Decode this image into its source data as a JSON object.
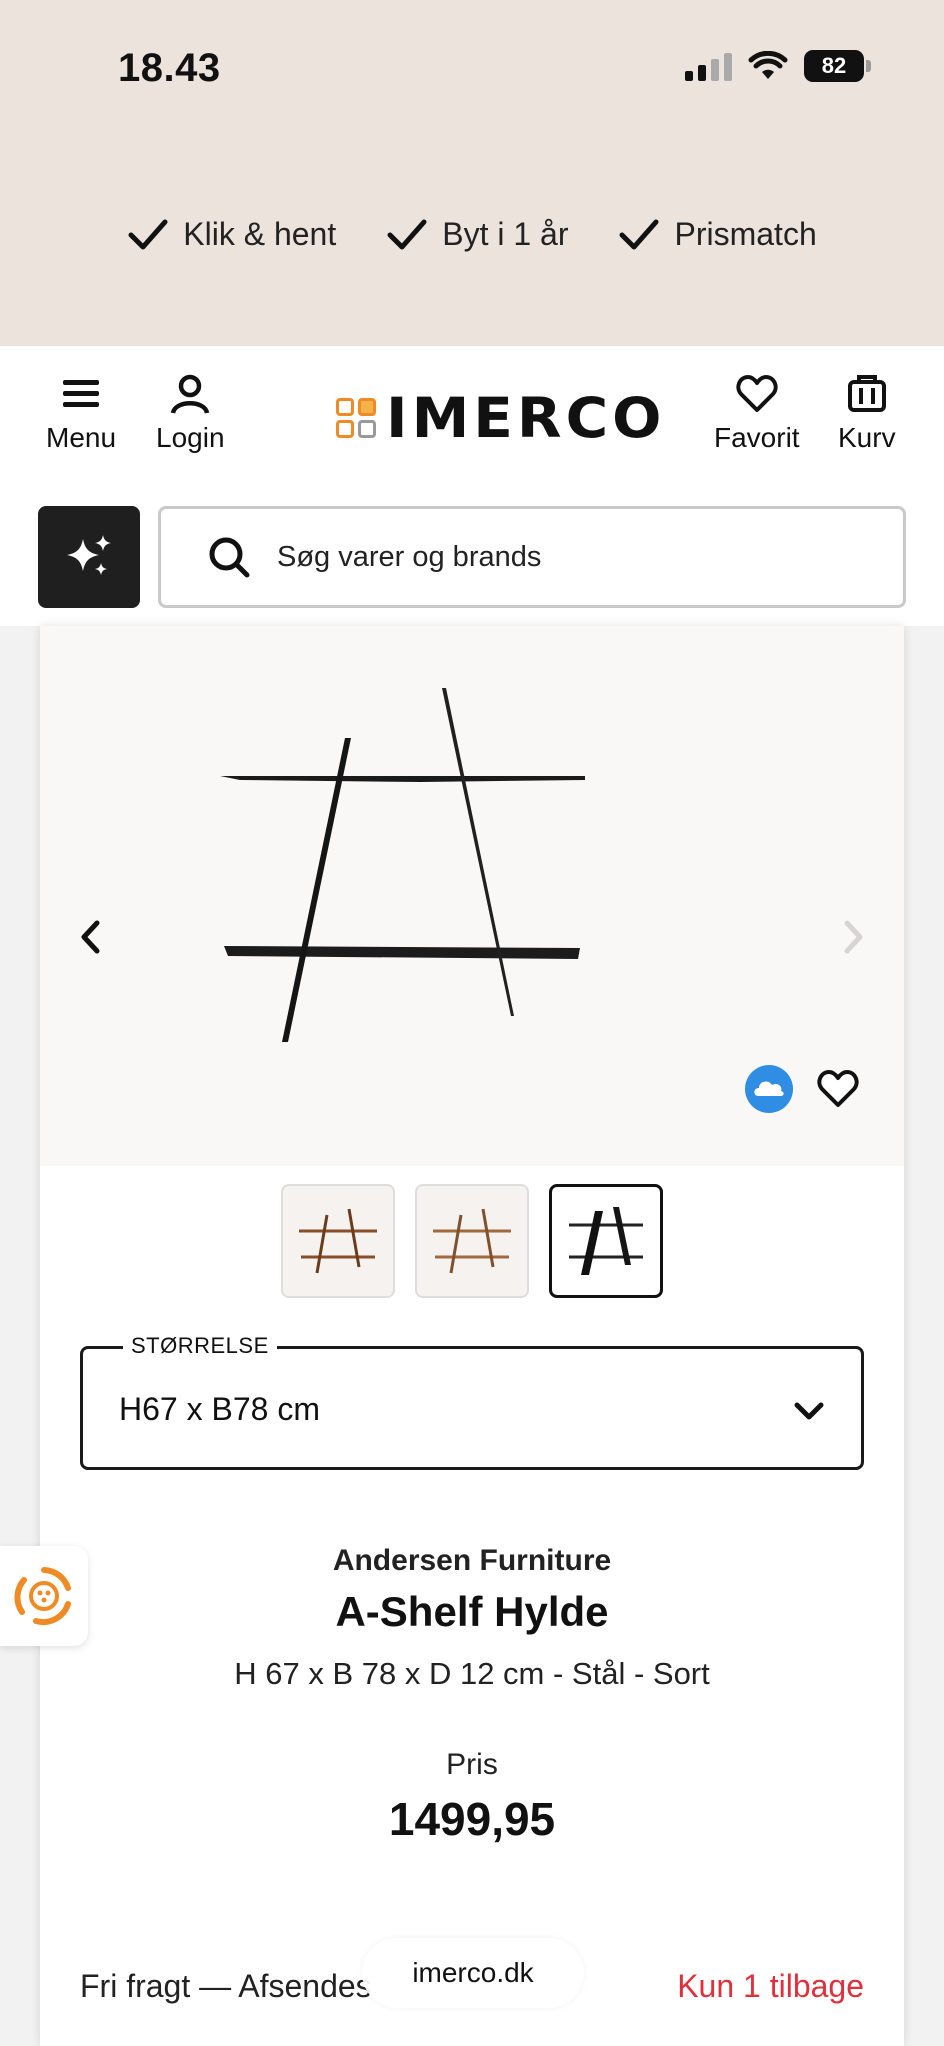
{
  "status_bar": {
    "time": "18.43",
    "battery": "82"
  },
  "usps": [
    "Klik & hent",
    "Byt i 1 år",
    "Prismatch"
  ],
  "header": {
    "menu_label": "Menu",
    "login_label": "Login",
    "logo_text": "IMERCO",
    "favorites_label": "Favorit",
    "cart_label": "Kurv"
  },
  "search": {
    "placeholder": "Søg varer og brands"
  },
  "size_selector": {
    "legend": "STØRRELSE",
    "value": "H67 x B78 cm"
  },
  "product": {
    "brand": "Andersen Furniture",
    "title": "A-Shelf Hylde",
    "spec": "H 67 x B 78 x D 12 cm - Stål - Sort",
    "price_label": "Pris",
    "price": "1499,95"
  },
  "delivery": {
    "shipping": "Fri fragt — Afsendes",
    "stock": "Kun 1 tilbage"
  },
  "browser": {
    "url": "imerco.dk"
  },
  "colors": {
    "accent": "#f08a24",
    "stock": "#e0303b",
    "top_band": "#ece3dc"
  }
}
